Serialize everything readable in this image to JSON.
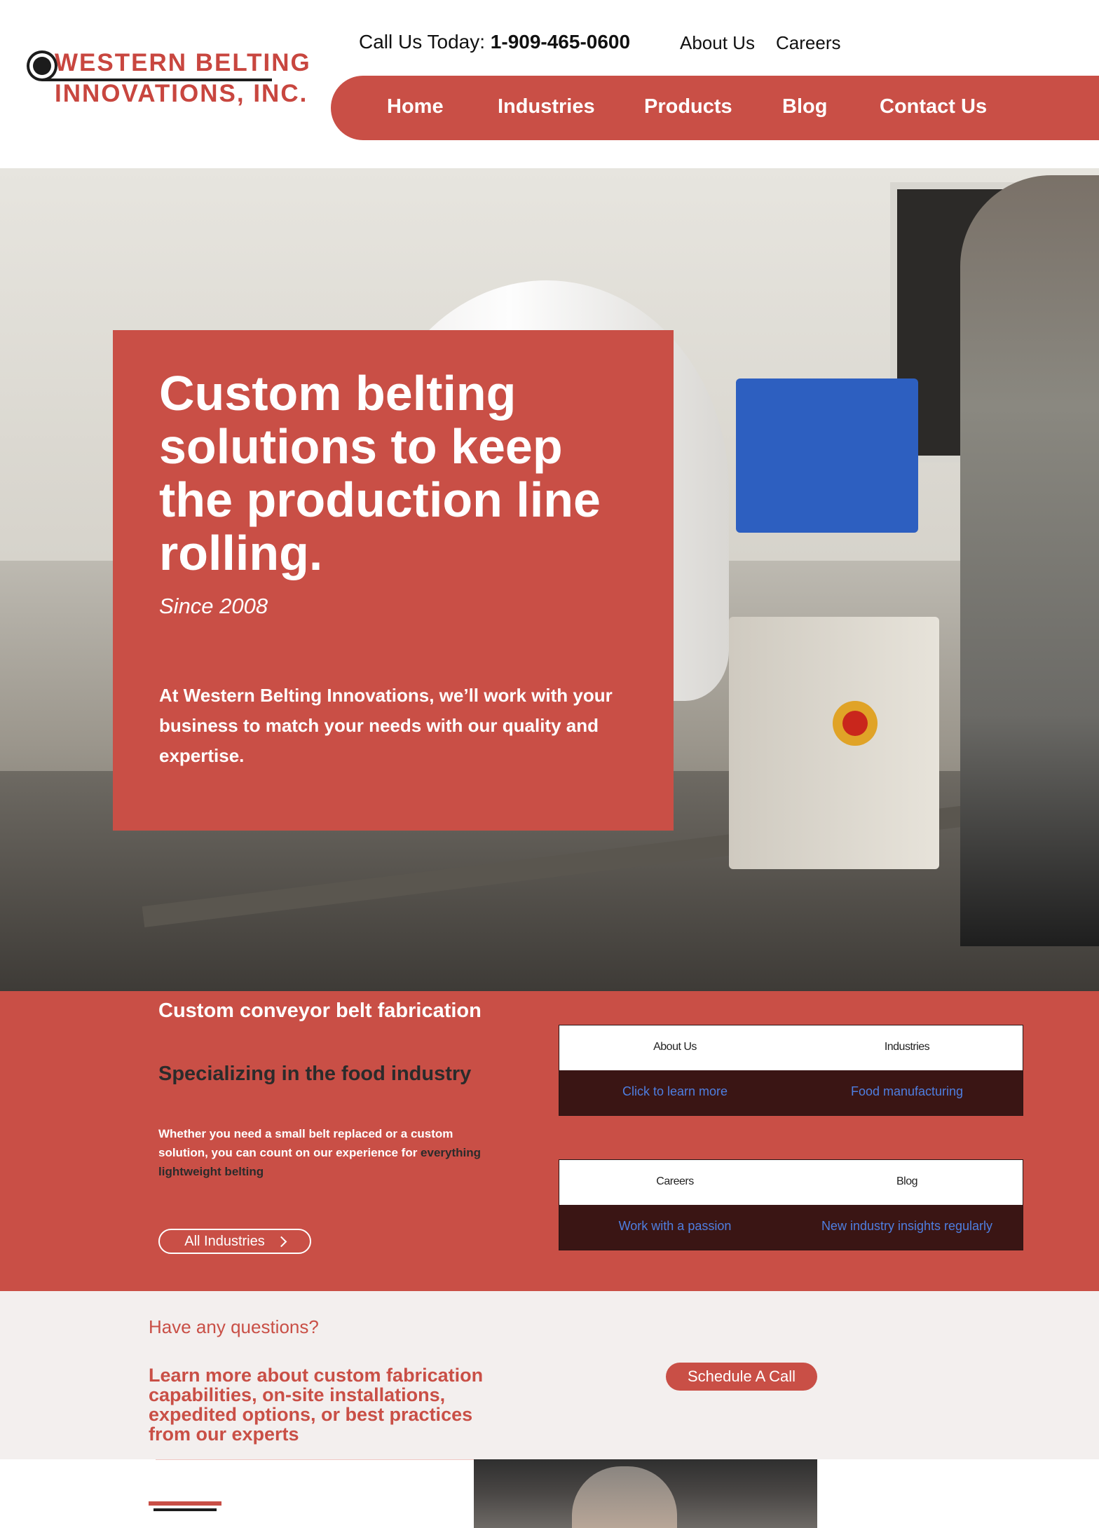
{
  "brand": {
    "line1": "WESTERN BELTING",
    "line2": "INNOVATIONS, INC.",
    "color": "#c94f46"
  },
  "header": {
    "call_prefix": "Call Us Today:",
    "phone": "1-909-465-0600",
    "top_links": [
      "About Us",
      "Careers"
    ]
  },
  "nav": {
    "items": [
      "Home",
      "Industries",
      "Products",
      "Blog",
      "Contact Us"
    ]
  },
  "hero": {
    "title": "Custom belting solutions to keep the production line rolling.",
    "since": "Since 2008",
    "body": "At Western Belting Innovations, we’ll work with your business to match your needs with our quality and expertise."
  },
  "info": {
    "heading": "Custom conveyor belt fabrication",
    "subheading": "Specializing in the food industry",
    "paragraph_start": "Whether you need a small belt replaced or a custom solution, you can count on our experience for ",
    "paragraph_highlight": "everything lightweight belting",
    "button_label": "All Industries",
    "cards": [
      {
        "left_label": "About Us",
        "left_link": "Click to learn more",
        "right_label": "Industries",
        "right_link": "Food manufacturing"
      },
      {
        "left_label": "Careers",
        "left_link": "Work with a passion",
        "right_label": "Blog",
        "right_link": "New industry insights regularly"
      }
    ]
  },
  "questions": {
    "small": "Have any questions?",
    "big": "Learn more about custom fabrication capabilities, on-site installations, expedited options, or best practices from our experts",
    "button_label": "Schedule A Call"
  },
  "icons": [
    "logo-ring-icon",
    "chevron-right-icon",
    "w-logo-icon"
  ]
}
